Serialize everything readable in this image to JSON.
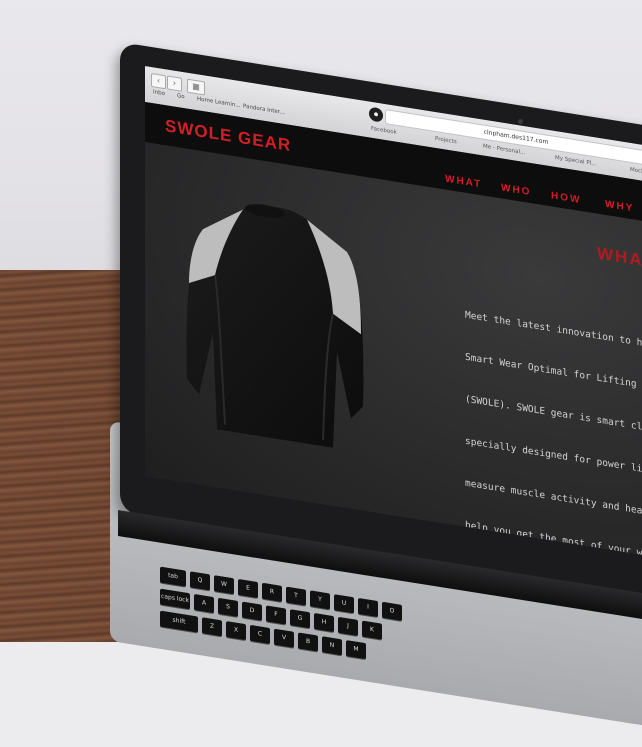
{
  "browser": {
    "address": "clnpham.des117.com",
    "bookmarks": [
      "Inbo",
      "Go",
      "Home Learnin...",
      "Pandora Inter..."
    ],
    "tabs": [
      "Facebook",
      "Projects",
      "Me - Personal...",
      "My Special Pl...",
      "Mock-Ups | G..."
    ]
  },
  "site": {
    "brand": "SWOLE GEAR",
    "menu": [
      "WHAT",
      "WHO",
      "HOW",
      "WHY"
    ],
    "section_title": "WHAT",
    "paragraph_lines": [
      "Meet the latest innovation to hit th",
      "Smart Wear Optimal for Lifting Exe",
      "(SWOLE). SWOLE gear is smart clo",
      "specially designed for power lifters",
      "measure muscle activity and heart ra",
      "help you get the most of your worko"
    ]
  },
  "keyboard": {
    "keys": [
      "tab",
      "caps lock",
      "shift",
      "Q",
      "W",
      "E",
      "R",
      "T",
      "Y",
      "U",
      "I",
      "O",
      "A",
      "S",
      "D",
      "F",
      "G",
      "H",
      "J",
      "K",
      "Z",
      "X",
      "C",
      "V",
      "B",
      "N",
      "M"
    ]
  },
  "colors": {
    "accent": "#d21f26",
    "site_bg": "#2d2d2e",
    "header_bg": "#0d0d0d"
  }
}
